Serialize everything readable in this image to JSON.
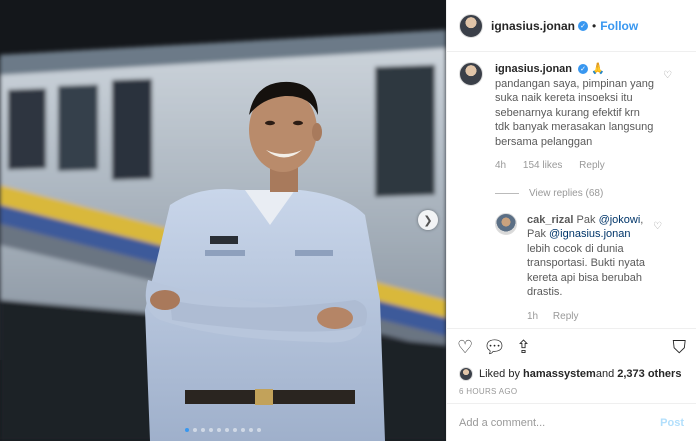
{
  "post": {
    "username": "ignasius.jonan",
    "separator": "•",
    "follow_label": "Follow",
    "carousel_next_icon": "chevron-right-icon",
    "carousel": {
      "count": 10,
      "active_index": 0
    }
  },
  "comments": [
    {
      "username": "ignasius.jonan",
      "emoji": "🙏",
      "text": "pandangan saya, pimpinan yang suka naik kereta insoeksi itu sebenarnya kurang efektif krn tdk banyak merasakan langsung bersama pelanggan",
      "time": "4h",
      "likes": "154 likes",
      "reply_label": "Reply",
      "view_replies": "View replies (68)"
    }
  ],
  "reply": {
    "username": "cak_rizal",
    "text_1": "Pak ",
    "mention_1": "@jokowi",
    "text_2": ", Pak ",
    "mention_2": "@ignasius.jonan",
    "text_3": " lebih cocok di dunia transportasi. Bukti nyata kereta api bisa berubah drastis.",
    "time": "1h",
    "reply_label": "Reply"
  },
  "actions": {
    "like_icon": "heart-icon",
    "comment_icon": "comment-icon",
    "share_icon": "share-icon",
    "save_icon": "bookmark-icon"
  },
  "likes": {
    "prefix": "Liked by ",
    "user": "hamassystem",
    "middle": " and ",
    "count": "2,373 others"
  },
  "timestamp": "6 HOURS AGO",
  "add_comment": {
    "placeholder": "Add a comment...",
    "post_label": "Post"
  },
  "colors": {
    "link_blue": "#3897f0",
    "post_disabled": "#b2dffc",
    "mention": "#003569"
  }
}
